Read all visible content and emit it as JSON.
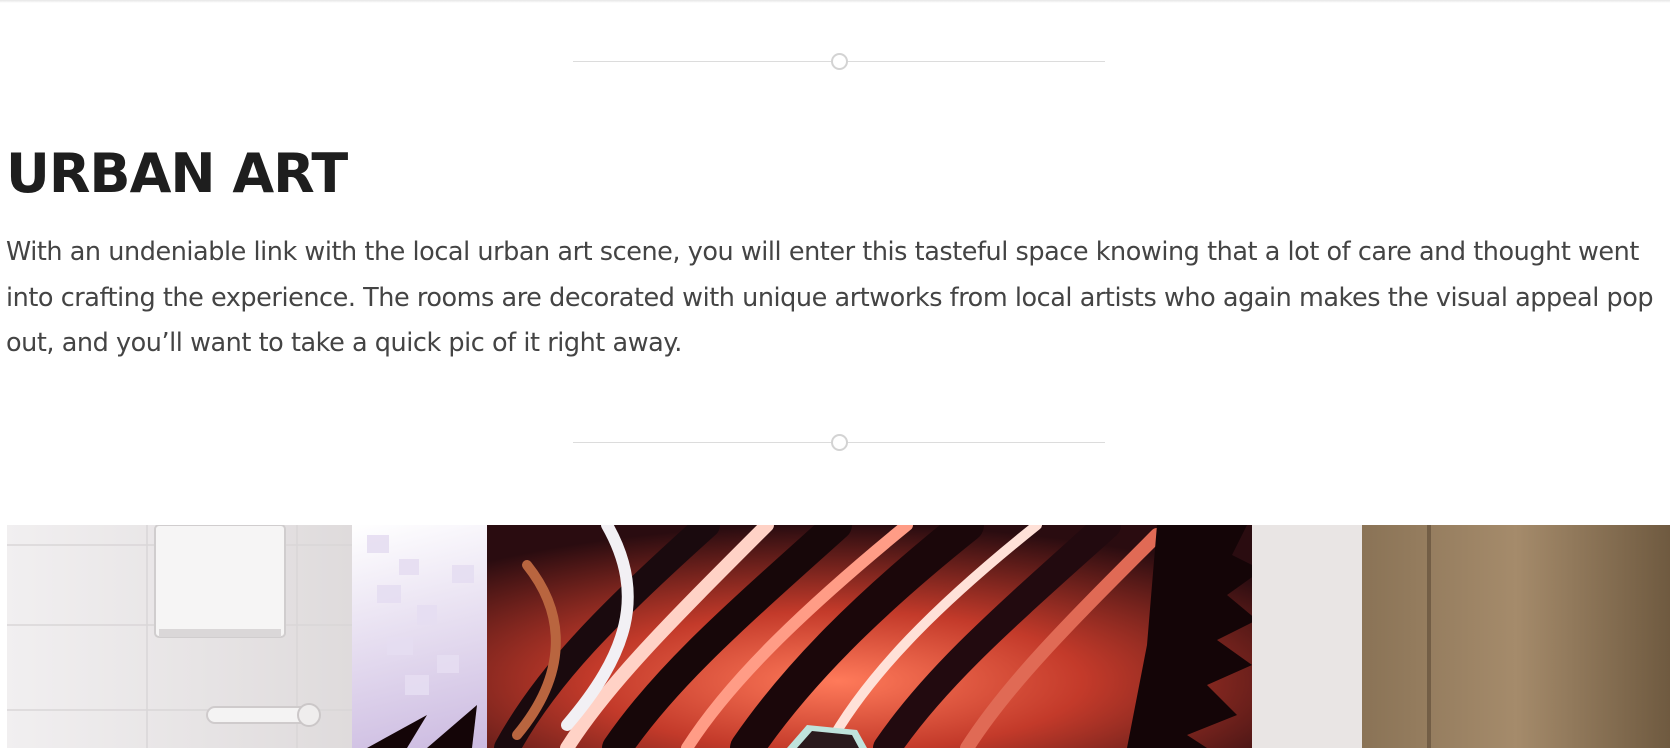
{
  "section": {
    "title": "URBAN ART",
    "description": "With an undeniable link with the local urban art scene, you will enter this tasteful space knowing that a lot of care and thought went into crafting the experience. The rooms are decorated with unique artworks from local artists who again makes the visual appeal pop out, and you’ll want to take a quick pic of it right away."
  },
  "colors": {
    "heading": "#1e1e1e",
    "body_text": "#444444",
    "divider": "#dcdcdc"
  }
}
